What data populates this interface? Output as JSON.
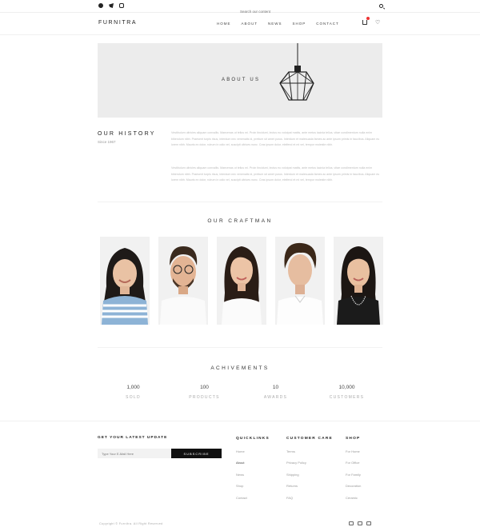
{
  "topbar": {
    "social": [
      "facebook-icon",
      "twitter-icon",
      "instagram-icon"
    ],
    "search_placeholder": "Search our content"
  },
  "header": {
    "logo": "FURNITRA",
    "nav": [
      "HOME",
      "ABOUT",
      "NEWS",
      "SHOP",
      "CONTACT"
    ]
  },
  "banner": {
    "title": "ABOUT US"
  },
  "history": {
    "title": "OUR HISTORY",
    "since": "Since 1967",
    "paragraphs": [
      "Vestibulum ultricies aliquam convallis. Maecenas ut tellus mi. Proin tincidunt, lectus eu volutpat mattis, ante metus lacinia tellus, vitae condimentum nulla enim bibendum nibh. Praesent turpis risus, interdum nec venenatis id, pretium sit amet purus. Interdum et malesuada fames ac ante ipsum primis in faucibus. Aliquam eu lorem nibh. Mauris ex dolor, rutrum in odio vel, suscipit ultrices nunc. Cras ipsum dolor, eleifend et mi vel, tempor molestie nibh.",
      "Vestibulum ultricies aliquam convallis. Maecenas ut tellus mi. Proin tincidunt, lectus eu volutpat mattis, ante metus lacinia tellus, vitae condimentum nulla enim bibendum nibh. Praesent turpis risus, interdum nec venenatis id, pretium sit amet purus. Interdum et malesuada fames ac ante ipsum primis in faucibus. Aliquam eu lorem nibh. Mauris ex dolor, rutrum in odio vel, suscipit ultrices nunc. Cras ipsum dolor, eleifend et mi vel, tempor molestie nibh."
    ]
  },
  "craftman": {
    "title": "OUR CRAFTMAN"
  },
  "achievements": {
    "title": "ACHIVEMENTS",
    "stats": [
      {
        "value": "1,000",
        "label": "SOLD"
      },
      {
        "value": "100",
        "label": "PRODUCTS"
      },
      {
        "value": "10",
        "label": "AWARDS"
      },
      {
        "value": "10,000",
        "label": "CUSTOMERS"
      }
    ]
  },
  "footer": {
    "newsletter_title": "GET YOUR LATEST UPDATE",
    "newsletter_placeholder": "Type Your E-Mail Here",
    "subscribe_label": "SUBSCRIBE",
    "quicklinks": {
      "title": "QUICKLINKS",
      "items": [
        "Home",
        "About",
        "News",
        "Shop",
        "Contact"
      ]
    },
    "customer_care": {
      "title": "CUSTOMER CARE",
      "items": [
        "Terms",
        "Privacy Policy",
        "Shipping",
        "Returns",
        "FAQ"
      ]
    },
    "shop": {
      "title": "SHOP",
      "items": [
        "For Home",
        "For Office",
        "For Family",
        "Decoration",
        "Ceramic"
      ]
    },
    "copyright": "Copyright © Furnitra. All Right Reserved",
    "payment_icons": [
      "card-icon",
      "card-icon",
      "card-icon"
    ]
  },
  "colors": {
    "accent": "#111111",
    "badge": "#e33333",
    "banner_bg": "#ececec"
  }
}
